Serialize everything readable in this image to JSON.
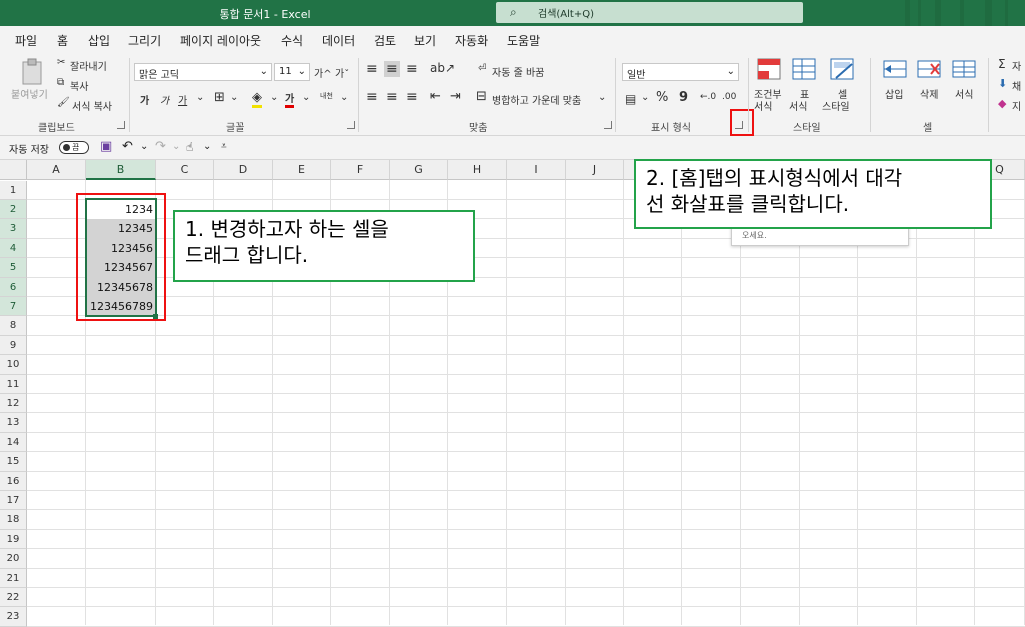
{
  "window": {
    "title": "통합 문서1  -  Excel",
    "search_placeholder": "검색(Alt+Q)"
  },
  "menu": {
    "tabs": [
      "파일",
      "홈",
      "삽입",
      "그리기",
      "페이지 레이아웃",
      "수식",
      "데이터",
      "검토",
      "보기",
      "자동화",
      "도움말"
    ],
    "active": "홈"
  },
  "ribbon": {
    "clipboard": {
      "paste": "붙여넣기",
      "cut": "잘라내기",
      "copy": "복사",
      "format_painter": "서식 복사",
      "group_label": "클립보드"
    },
    "font": {
      "font_name": "맑은 고딕",
      "font_size": "11",
      "grow": "가^",
      "shrink": "가ˇ",
      "bold": "가",
      "italic": "가",
      "underline": "가",
      "phonetic": "내천",
      "color_a": "가",
      "group_label": "글꼴"
    },
    "alignment": {
      "wrap_text": "자동 줄 바꿈",
      "merge_center": "병합하고 가운데 맞춤",
      "group_label": "맞춤"
    },
    "number": {
      "format": "일반",
      "percent": "%",
      "comma": "9",
      "dec_inc": "←.0",
      "dec_dec": ".00",
      "group_label": "표시 형식"
    },
    "styles": {
      "conditional_1": "조건부",
      "conditional_2": "서식",
      "table_1": "표",
      "table_2": "서식",
      "cell_1": "셀",
      "cell_2": "스타일",
      "group_label": "스타일"
    },
    "cells": {
      "insert": "삽입",
      "delete": "삭제",
      "format": "서식",
      "group_label": "셀"
    },
    "editing": {
      "autosum": "자",
      "fill": "채",
      "clear": "지"
    }
  },
  "qat": {
    "autosave": "자동 저장",
    "toggle": "끔"
  },
  "sheet": {
    "columns": [
      "A",
      "B",
      "C",
      "D",
      "E",
      "F",
      "G",
      "H",
      "I",
      "J",
      "K",
      "L",
      "M",
      "N",
      "O",
      "P",
      "Q"
    ],
    "selected_column": "B",
    "rows": [
      "1",
      "2",
      "3",
      "4",
      "5",
      "6",
      "7",
      "8",
      "9",
      "10",
      "11",
      "12",
      "13",
      "14",
      "15",
      "16",
      "17",
      "18",
      "19",
      "20",
      "21",
      "22",
      "23"
    ],
    "b_values": [
      "1234",
      "12345",
      "123456",
      "1234567",
      "12345678",
      "123456789"
    ],
    "tooltip_fragment": "오세요."
  },
  "annotations": {
    "step1": "1. 변경하고자 하는 셀을\n드래그 합니다.",
    "step2": "2. [홈]탭의 표시형식에서 대각\n선 화살표를 클릭합니다."
  },
  "colors": {
    "excel_green": "#217346",
    "annotation_border": "#23a34a",
    "highlight_red": "#ee1111",
    "selection_fill": "#d3d3d3"
  }
}
